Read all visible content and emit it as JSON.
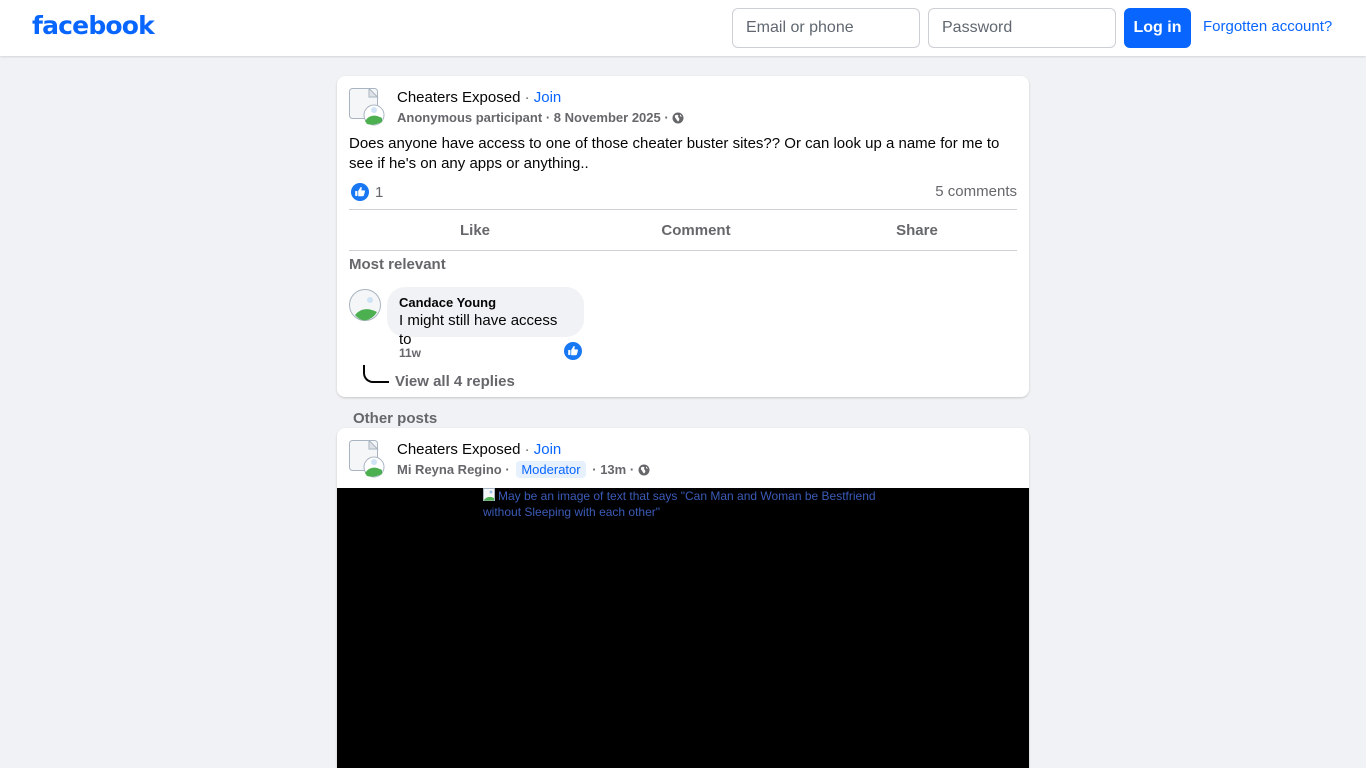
{
  "header": {
    "logo": "facebook",
    "email_placeholder": "Email or phone",
    "password_placeholder": "Password",
    "login_label": "Log in",
    "forgot_label": "Forgotten account?"
  },
  "post": {
    "group_name": "Cheaters Exposed",
    "separator": "·",
    "join_label": "Join",
    "author": "Anonymous participant",
    "date": "8 November 2025",
    "text": "Does anyone have access to one of those cheater buster sites?? Or can look up a name for me to see if he's on any apps or anything..",
    "like_count": "1",
    "comments_count": "5 comments",
    "actions": {
      "like": "Like",
      "comment": "Comment",
      "share": "Share"
    },
    "sort_label": "Most relevant",
    "comment": {
      "author": "Candace Young",
      "text": "I might still have access to",
      "time": "11w",
      "view_replies": "View all 4 replies"
    }
  },
  "other_posts": {
    "heading": "Other posts",
    "post": {
      "group_name": "Cheaters Exposed",
      "separator": "·",
      "join_label": "Join",
      "author": "Mi Reyna Regino",
      "badge": "Moderator",
      "time": "13m",
      "image_alt": "May be an image of text that says \"Can Man and Woman be Bestfriend without Sleeping with each other\""
    }
  },
  "colors": {
    "brand_blue": "#0866ff",
    "background": "#f0f2f5",
    "secondary_text": "#65676b"
  },
  "icons": {
    "globe": "globe-icon",
    "like": "like-thumb-icon",
    "avatar": "broken-image-avatar-icon"
  }
}
